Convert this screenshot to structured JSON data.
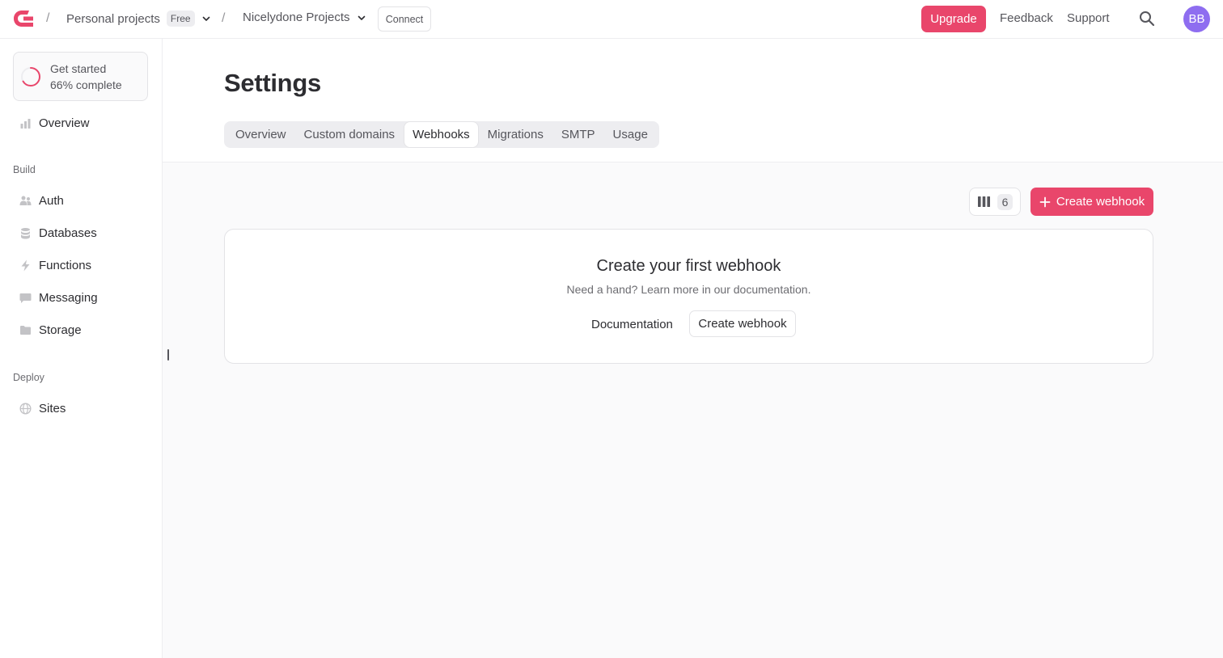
{
  "topbar": {
    "logo_icon": "appwrite-logo-icon",
    "org_name": "Personal projects",
    "plan_badge": "Free",
    "project_name": "Nicelydone Projects",
    "connect_label": "Connect",
    "upgrade_label": "Upgrade",
    "feedback_label": "Feedback",
    "support_label": "Support",
    "avatar_initials": "BB",
    "brand_color": "#e9466b",
    "avatar_color": "#8e6df0"
  },
  "sidebar": {
    "get_started": {
      "title": "Get started",
      "progress_text": "66% complete",
      "progress_value": 0.66
    },
    "overview_label": "Overview",
    "build_section": "Build",
    "build_items": [
      {
        "label": "Auth",
        "icon": "users-icon"
      },
      {
        "label": "Databases",
        "icon": "database-icon"
      },
      {
        "label": "Functions",
        "icon": "lightning-icon"
      },
      {
        "label": "Messaging",
        "icon": "chat-icon"
      },
      {
        "label": "Storage",
        "icon": "folder-icon"
      }
    ],
    "deploy_section": "Deploy",
    "deploy_items": [
      {
        "label": "Sites",
        "icon": "globe-icon"
      }
    ]
  },
  "header": {
    "title": "Settings",
    "tabs": [
      {
        "label": "Overview",
        "active": false
      },
      {
        "label": "Custom domains",
        "active": false
      },
      {
        "label": "Webhooks",
        "active": true
      },
      {
        "label": "Migrations",
        "active": false
      },
      {
        "label": "SMTP",
        "active": false
      },
      {
        "label": "Usage",
        "active": false
      }
    ]
  },
  "toolbar": {
    "columns_count": "6",
    "create_label": "Create webhook"
  },
  "empty_state": {
    "title": "Create your first webhook",
    "subtitle": "Need a hand? Learn more in our documentation.",
    "documentation_label": "Documentation",
    "create_label": "Create webhook"
  }
}
